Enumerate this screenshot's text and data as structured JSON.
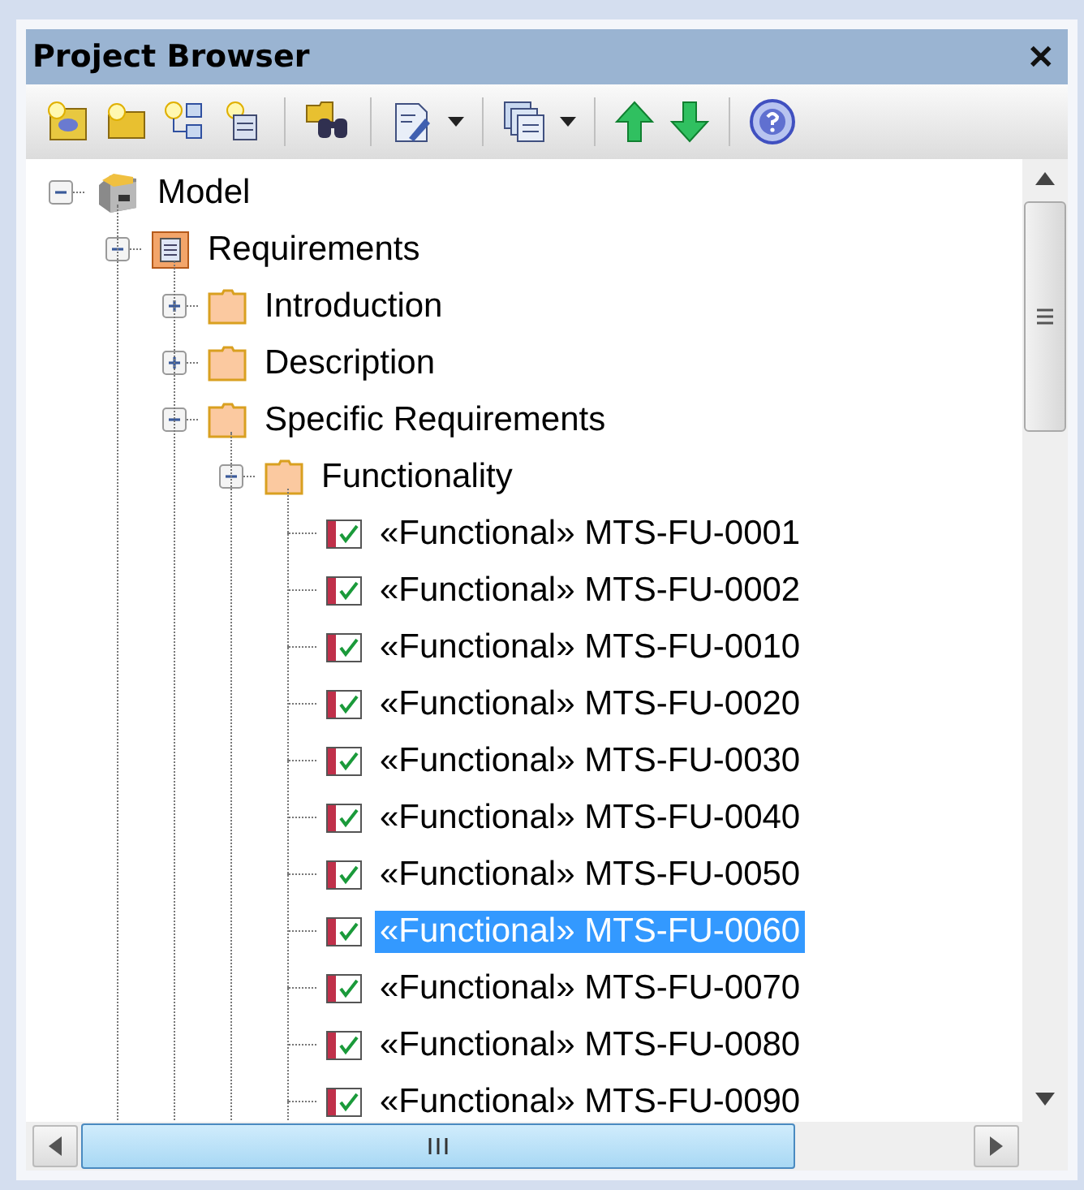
{
  "window": {
    "title": "Project Browser",
    "close": "✕"
  },
  "tree": [
    {
      "label": "Model",
      "kind": "model",
      "expanded": true,
      "children": [
        {
          "label": "Requirements",
          "kind": "package",
          "expanded": true,
          "children": [
            {
              "label": "Introduction",
              "kind": "folder",
              "expanded": false
            },
            {
              "label": "Description",
              "kind": "folder",
              "expanded": false
            },
            {
              "label": "Specific Requirements",
              "kind": "folder",
              "expanded": true,
              "children": [
                {
                  "label": "Functionality",
                  "kind": "folder",
                  "expanded": true,
                  "children": [
                    {
                      "label": "«Functional» MTS-FU-0001",
                      "kind": "requirement",
                      "selected": false
                    },
                    {
                      "label": "«Functional» MTS-FU-0002",
                      "kind": "requirement",
                      "selected": false
                    },
                    {
                      "label": "«Functional» MTS-FU-0010",
                      "kind": "requirement",
                      "selected": false
                    },
                    {
                      "label": "«Functional» MTS-FU-0020",
                      "kind": "requirement",
                      "selected": false
                    },
                    {
                      "label": "«Functional» MTS-FU-0030",
                      "kind": "requirement",
                      "selected": false
                    },
                    {
                      "label": "«Functional» MTS-FU-0040",
                      "kind": "requirement",
                      "selected": false
                    },
                    {
                      "label": "«Functional» MTS-FU-0050",
                      "kind": "requirement",
                      "selected": false
                    },
                    {
                      "label": "«Functional» MTS-FU-0060",
                      "kind": "requirement",
                      "selected": true
                    },
                    {
                      "label": "«Functional» MTS-FU-0070",
                      "kind": "requirement",
                      "selected": false
                    },
                    {
                      "label": "«Functional» MTS-FU-0080",
                      "kind": "requirement",
                      "selected": false
                    },
                    {
                      "label": "«Functional» MTS-FU-0090",
                      "kind": "requirement",
                      "selected": false
                    }
                  ]
                }
              ]
            }
          ]
        }
      ]
    }
  ]
}
